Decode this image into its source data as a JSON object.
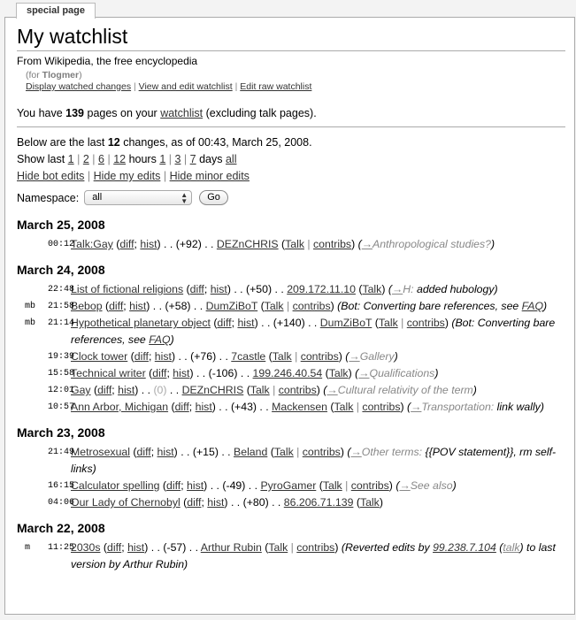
{
  "tab": {
    "label": "special page"
  },
  "page": {
    "title": "My watchlist",
    "site_sub": "From Wikipedia, the free encyclopedia",
    "for_prefix": "(for ",
    "user": "Tlogmer",
    "for_suffix": ")",
    "sub_links": [
      "Display watched changes",
      "View and edit watchlist",
      "Edit raw watchlist"
    ],
    "sub_sep": "|"
  },
  "summary": {
    "pre": "You have ",
    "count": "139",
    "mid": " pages on your ",
    "link": "watchlist",
    "post": " (excluding talk pages)."
  },
  "changes_info": {
    "pre": "Below are the last ",
    "count": "12",
    "post": " changes, as of 00:43, March 25, 2008."
  },
  "show_last": {
    "label": "Show last ",
    "hours": [
      "1",
      "2",
      "6",
      "12"
    ],
    "hours_label": " hours ",
    "days": [
      "1",
      "3",
      "7"
    ],
    "days_label": " days ",
    "all": "all",
    "sep": "|"
  },
  "hide_links": [
    "Hide bot edits",
    "Hide my edits",
    "Hide minor edits"
  ],
  "namespace": {
    "label": "Namespace:",
    "selected": "all",
    "go": "Go"
  },
  "strings": {
    "diff": "diff",
    "hist": "hist",
    "talk": "Talk",
    "contribs": "contribs",
    "dots": " . . ",
    "arrow": "→"
  },
  "days": [
    {
      "date": "March 25, 2008",
      "entries": [
        {
          "flags": "",
          "time": "00:12",
          "page": "Talk:Gay",
          "size": "(+92)",
          "user": "DEZnCHRIS",
          "contribs": true,
          "section": "Anthropological studies?",
          "comment": ""
        }
      ]
    },
    {
      "date": "March 24, 2008",
      "entries": [
        {
          "flags": "",
          "time": "22:48",
          "page": "List of fictional religions",
          "size": "(+50)",
          "user": "209.172.11.10",
          "contribs": false,
          "section": "H:",
          "comment": " added hubology"
        },
        {
          "flags": "mb",
          "time": "21:58",
          "page": "Bebop",
          "size": "(+58)",
          "user": "DumZiBoT",
          "contribs": true,
          "section": "",
          "comment": "Bot: Converting bare references, see ",
          "comment_link": "FAQ"
        },
        {
          "flags": "mb",
          "time": "21:14",
          "page": "Hypothetical planetary object",
          "size": "(+140)",
          "user": "DumZiBoT",
          "contribs": true,
          "section": "",
          "comment": "Bot: Converting bare references, see ",
          "comment_link": "FAQ"
        },
        {
          "flags": "",
          "time": "19:39",
          "page": "Clock tower",
          "size": "(+76)",
          "user": "7castle",
          "contribs": true,
          "section": "Gallery",
          "comment": ""
        },
        {
          "flags": "",
          "time": "15:58",
          "page": "Technical writer",
          "size": "(-106)",
          "user": "199.246.40.54",
          "contribs": false,
          "section": "Qualifications",
          "comment": ""
        },
        {
          "flags": "",
          "time": "12:01",
          "page": "Gay",
          "size": "(0)",
          "neutral": true,
          "user": "DEZnCHRIS",
          "contribs": true,
          "section": "Cultural relativity of the term",
          "comment": ""
        },
        {
          "flags": "",
          "time": "10:57",
          "page": "Ann Arbor, Michigan",
          "size": "(+43)",
          "user": "Mackensen",
          "contribs": true,
          "section": "Transportation:",
          "comment": " link wally"
        }
      ]
    },
    {
      "date": "March 23, 2008",
      "entries": [
        {
          "flags": "",
          "time": "21:49",
          "page": "Metrosexual",
          "size": "(+15)",
          "user": "Beland",
          "contribs": true,
          "section": "Other terms:",
          "comment": " {{POV statement}}, rm self-links"
        },
        {
          "flags": "",
          "time": "16:15",
          "page": "Calculator spelling",
          "size": "(-49)",
          "user": "PyroGamer",
          "contribs": true,
          "section": "See also",
          "comment": ""
        },
        {
          "flags": "",
          "time": "04:06",
          "page": "Our Lady of Chernobyl",
          "size": "(+80)",
          "user": "86.206.71.139",
          "contribs": false,
          "section": "",
          "comment": ""
        }
      ]
    },
    {
      "date": "March 22, 2008",
      "entries": [
        {
          "flags": "m",
          "time": "11:25",
          "page": "2030s",
          "size": "(-57)",
          "user": "Arthur Rubin",
          "contribs": true,
          "section": "",
          "comment": "Reverted edits by ",
          "comment_link": "99.238.7.104",
          "comment_link2": "talk",
          "comment_tail": " to last version by Arthur Rubin"
        }
      ]
    }
  ]
}
